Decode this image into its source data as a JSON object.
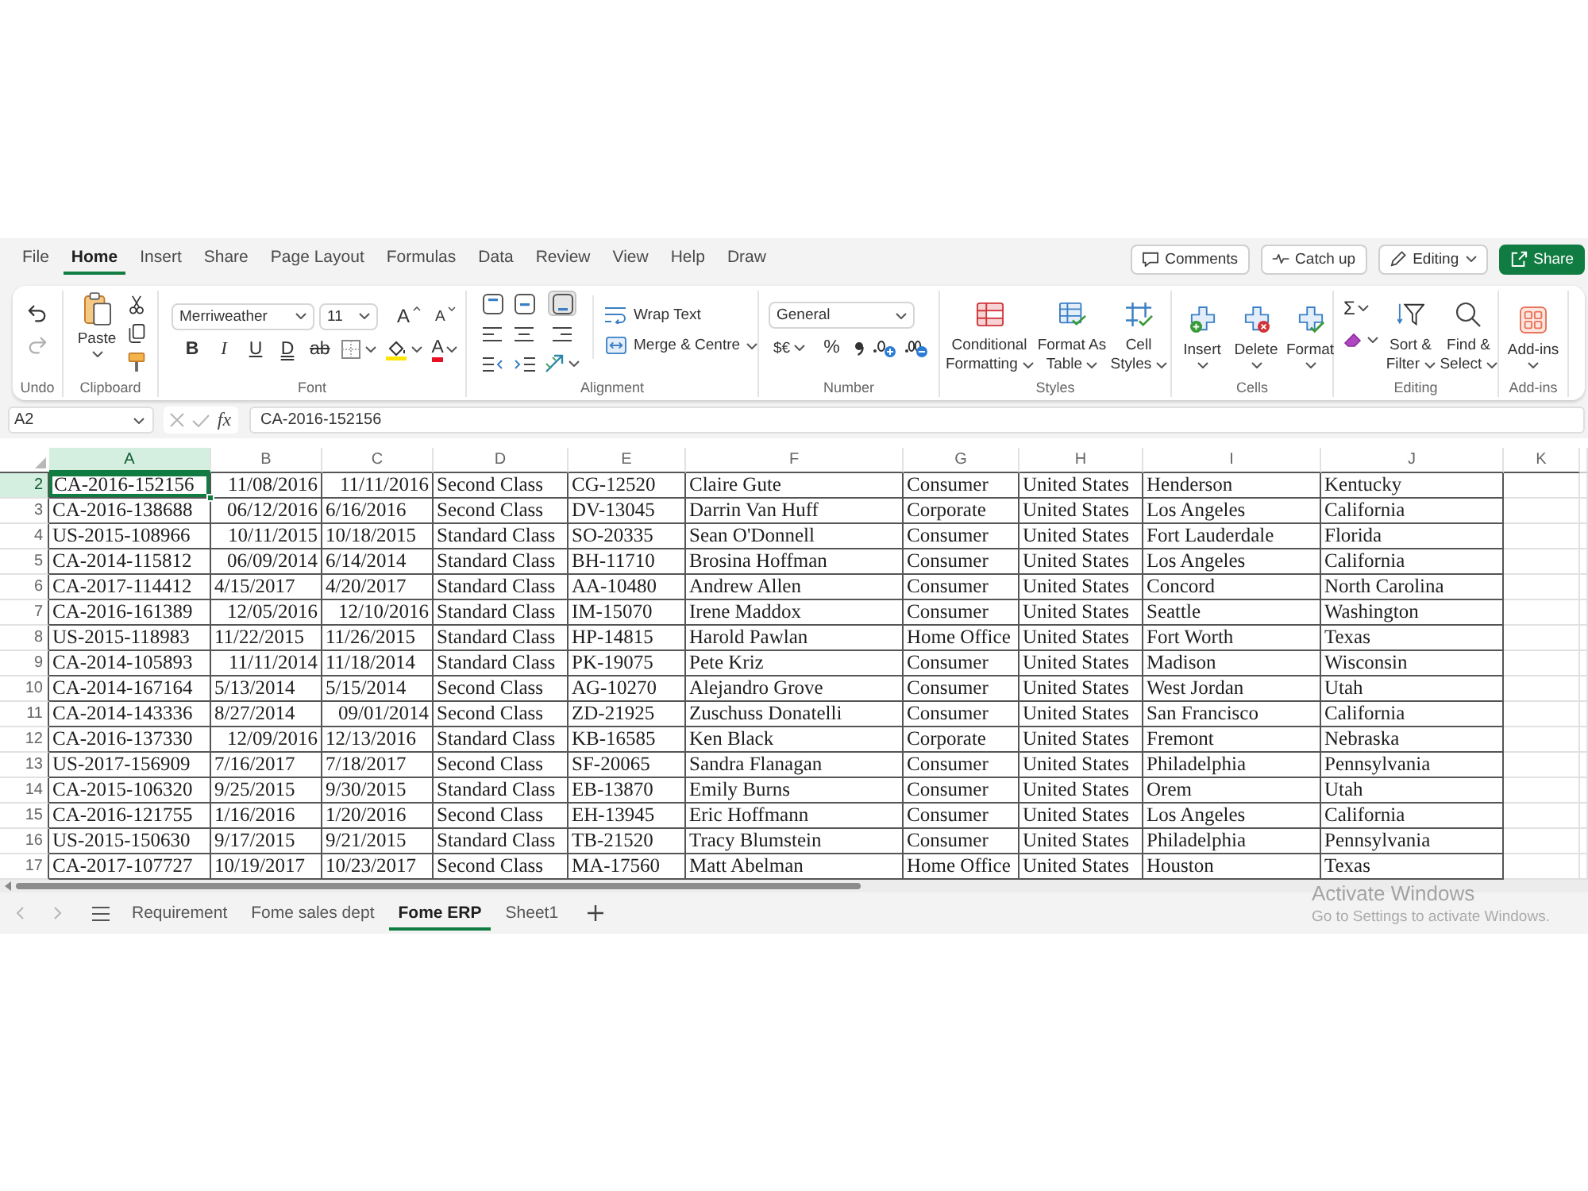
{
  "menu_tabs": [
    {
      "label": "File",
      "selected": false
    },
    {
      "label": "Home",
      "selected": true
    },
    {
      "label": "Insert",
      "selected": false
    },
    {
      "label": "Share",
      "selected": false
    },
    {
      "label": "Page Layout",
      "selected": false
    },
    {
      "label": "Formulas",
      "selected": false
    },
    {
      "label": "Data",
      "selected": false
    },
    {
      "label": "Review",
      "selected": false
    },
    {
      "label": "View",
      "selected": false
    },
    {
      "label": "Help",
      "selected": false
    },
    {
      "label": "Draw",
      "selected": false
    }
  ],
  "header_actions": [
    {
      "kind": "comments",
      "label": "Comments"
    },
    {
      "kind": "catch_up",
      "label": "Catch up"
    },
    {
      "kind": "editing",
      "label": "Editing"
    },
    {
      "kind": "share",
      "label": "Share"
    }
  ],
  "ribbon": {
    "groups": [
      {
        "kind": "undo",
        "label": "Undo"
      },
      {
        "kind": "clipboard",
        "label": "Clipboard",
        "paste": "Paste"
      },
      {
        "kind": "font",
        "label": "Font",
        "font_name": "Merriweather",
        "font_size": "11",
        "size_buttons": [
          {
            "kind": "grow",
            "glyph": "A"
          },
          {
            "kind": "shrink",
            "glyph": "A"
          }
        ],
        "style_buttons": [
          {
            "kind": "bold",
            "glyph": "B"
          },
          {
            "kind": "italic",
            "glyph": "I"
          },
          {
            "kind": "underline",
            "glyph": "U"
          },
          {
            "kind": "double_underline",
            "glyph": "D"
          },
          {
            "kind": "strikethrough",
            "glyph": "ab"
          }
        ],
        "font_color_glyph": "A"
      },
      {
        "kind": "alignment",
        "label": "Alignment",
        "vertical": [
          {
            "kind": "top",
            "selected": false
          },
          {
            "kind": "middle",
            "selected": false
          },
          {
            "kind": "bottom",
            "selected": true
          }
        ],
        "wrap_text": "Wrap Text",
        "merge": "Merge & Centre"
      },
      {
        "kind": "number",
        "label": "Number",
        "format": "General",
        "currency": "$€",
        "percent": "%"
      },
      {
        "kind": "styles",
        "label": "Styles",
        "buttons": [
          {
            "kind": "conditional",
            "label": "Conditional Formatting"
          },
          {
            "kind": "table",
            "label": "Format As Table"
          },
          {
            "kind": "cell_styles",
            "label": "Cell Styles"
          }
        ]
      },
      {
        "kind": "cells",
        "label": "Cells",
        "buttons": [
          {
            "kind": "insert",
            "label": "Insert"
          },
          {
            "kind": "delete",
            "label": "Delete"
          },
          {
            "kind": "format",
            "label": "Format"
          }
        ]
      },
      {
        "kind": "editing",
        "label": "Editing",
        "sum": "Σ",
        "buttons": [
          {
            "kind": "sort",
            "label": "Sort & Filter"
          },
          {
            "kind": "find",
            "label": "Find & Select"
          }
        ]
      },
      {
        "kind": "addins",
        "label": "Add-ins",
        "button": "Add-ins"
      }
    ]
  },
  "formula_bar": {
    "name_box": "A2",
    "function_glyph": "fx",
    "value": "CA-2016-152156"
  },
  "sheet": {
    "columns": [
      {
        "label": "A",
        "selected": true
      },
      {
        "label": "B",
        "selected": false
      },
      {
        "label": "C",
        "selected": false
      },
      {
        "label": "D",
        "selected": false
      },
      {
        "label": "E",
        "selected": false
      },
      {
        "label": "F",
        "selected": false
      },
      {
        "label": "G",
        "selected": false
      },
      {
        "label": "H",
        "selected": false
      },
      {
        "label": "I",
        "selected": false
      },
      {
        "label": "J",
        "selected": false
      },
      {
        "label": "K",
        "selected": false
      }
    ],
    "rows": [
      {
        "header": "2",
        "selected": true,
        "cells": [
          "CA-2016-152156",
          {
            "text": "11/08/2016",
            "right_aligned": true
          },
          {
            "text": "11/11/2016",
            "right_aligned": true
          },
          "Second Class",
          "CG-12520",
          "Claire Gute",
          "Consumer",
          "United States",
          "Henderson",
          "Kentucky"
        ]
      },
      {
        "header": "3",
        "selected": false,
        "cells": [
          "CA-2016-138688",
          {
            "text": "06/12/2016",
            "right_aligned": true
          },
          {
            "text": "6/16/2016",
            "right_aligned": false
          },
          "Second Class",
          "DV-13045",
          "Darrin Van Huff",
          "Corporate",
          "United States",
          "Los Angeles",
          "California"
        ]
      },
      {
        "header": "4",
        "selected": false,
        "cells": [
          "US-2015-108966",
          {
            "text": "10/11/2015",
            "right_aligned": true
          },
          {
            "text": "10/18/2015",
            "right_aligned": false
          },
          "Standard Class",
          "SO-20335",
          "Sean O'Donnell",
          "Consumer",
          "United States",
          "Fort Lauderdale",
          "Florida"
        ]
      },
      {
        "header": "5",
        "selected": false,
        "cells": [
          "CA-2014-115812",
          {
            "text": "06/09/2014",
            "right_aligned": true
          },
          {
            "text": "6/14/2014",
            "right_aligned": false
          },
          "Standard Class",
          "BH-11710",
          "Brosina Hoffman",
          "Consumer",
          "United States",
          "Los Angeles",
          "California"
        ]
      },
      {
        "header": "6",
        "selected": false,
        "cells": [
          "CA-2017-114412",
          {
            "text": "4/15/2017",
            "right_aligned": false
          },
          {
            "text": "4/20/2017",
            "right_aligned": false
          },
          "Standard Class",
          "AA-10480",
          "Andrew Allen",
          "Consumer",
          "United States",
          "Concord",
          "North Carolina"
        ]
      },
      {
        "header": "7",
        "selected": false,
        "cells": [
          "CA-2016-161389",
          {
            "text": "12/05/2016",
            "right_aligned": true
          },
          {
            "text": "12/10/2016",
            "right_aligned": true
          },
          "Standard Class",
          "IM-15070",
          "Irene Maddox",
          "Consumer",
          "United States",
          "Seattle",
          "Washington"
        ]
      },
      {
        "header": "8",
        "selected": false,
        "cells": [
          "US-2015-118983",
          {
            "text": "11/22/2015",
            "right_aligned": false
          },
          {
            "text": "11/26/2015",
            "right_aligned": false
          },
          "Standard Class",
          "HP-14815",
          "Harold Pawlan",
          "Home Office",
          "United States",
          "Fort Worth",
          "Texas"
        ]
      },
      {
        "header": "9",
        "selected": false,
        "cells": [
          "CA-2014-105893",
          {
            "text": "11/11/2014",
            "right_aligned": true
          },
          {
            "text": "11/18/2014",
            "right_aligned": false
          },
          "Standard Class",
          "PK-19075",
          "Pete Kriz",
          "Consumer",
          "United States",
          "Madison",
          "Wisconsin"
        ]
      },
      {
        "header": "10",
        "selected": false,
        "cells": [
          "CA-2014-167164",
          {
            "text": "5/13/2014",
            "right_aligned": false
          },
          {
            "text": "5/15/2014",
            "right_aligned": false
          },
          "Second Class",
          "AG-10270",
          "Alejandro Grove",
          "Consumer",
          "United States",
          "West Jordan",
          "Utah"
        ]
      },
      {
        "header": "11",
        "selected": false,
        "cells": [
          "CA-2014-143336",
          {
            "text": "8/27/2014",
            "right_aligned": false
          },
          {
            "text": "09/01/2014",
            "right_aligned": true
          },
          "Second Class",
          "ZD-21925",
          "Zuschuss Donatelli",
          "Consumer",
          "United States",
          "San Francisco",
          "California"
        ]
      },
      {
        "header": "12",
        "selected": false,
        "cells": [
          "CA-2016-137330",
          {
            "text": "12/09/2016",
            "right_aligned": true
          },
          {
            "text": "12/13/2016",
            "right_aligned": false
          },
          "Standard Class",
          "KB-16585",
          "Ken Black",
          "Corporate",
          "United States",
          "Fremont",
          "Nebraska"
        ]
      },
      {
        "header": "13",
        "selected": false,
        "cells": [
          "US-2017-156909",
          {
            "text": "7/16/2017",
            "right_aligned": false
          },
          {
            "text": "7/18/2017",
            "right_aligned": false
          },
          "Second Class",
          "SF-20065",
          "Sandra Flanagan",
          "Consumer",
          "United States",
          "Philadelphia",
          "Pennsylvania"
        ]
      },
      {
        "header": "14",
        "selected": false,
        "cells": [
          "CA-2015-106320",
          {
            "text": "9/25/2015",
            "right_aligned": false
          },
          {
            "text": "9/30/2015",
            "right_aligned": false
          },
          "Standard Class",
          "EB-13870",
          "Emily Burns",
          "Consumer",
          "United States",
          "Orem",
          "Utah"
        ]
      },
      {
        "header": "15",
        "selected": false,
        "cells": [
          "CA-2016-121755",
          {
            "text": "1/16/2016",
            "right_aligned": false
          },
          {
            "text": "1/20/2016",
            "right_aligned": false
          },
          "Second Class",
          "EH-13945",
          "Eric Hoffmann",
          "Consumer",
          "United States",
          "Los Angeles",
          "California"
        ]
      },
      {
        "header": "16",
        "selected": false,
        "cells": [
          "US-2015-150630",
          {
            "text": "9/17/2015",
            "right_aligned": false
          },
          {
            "text": "9/21/2015",
            "right_aligned": false
          },
          "Standard Class",
          "TB-21520",
          "Tracy Blumstein",
          "Consumer",
          "United States",
          "Philadelphia",
          "Pennsylvania"
        ]
      },
      {
        "header": "17",
        "selected": false,
        "cells": [
          "CA-2017-107727",
          {
            "text": "10/19/2017",
            "right_aligned": false
          },
          {
            "text": "10/23/2017",
            "right_aligned": false
          },
          "Second Class",
          "MA-17560",
          "Matt Abelman",
          "Home Office",
          "United States",
          "Houston",
          "Texas"
        ]
      }
    ]
  },
  "sheet_tabs": [
    {
      "label": "Requirement",
      "selected": false
    },
    {
      "label": "Fome sales dept",
      "selected": false
    },
    {
      "label": "Fome ERP",
      "selected": true
    },
    {
      "label": "Sheet1",
      "selected": false
    }
  ],
  "system_notice": {
    "title": "Activate Windows",
    "message": "Go to Settings to activate Windows."
  }
}
